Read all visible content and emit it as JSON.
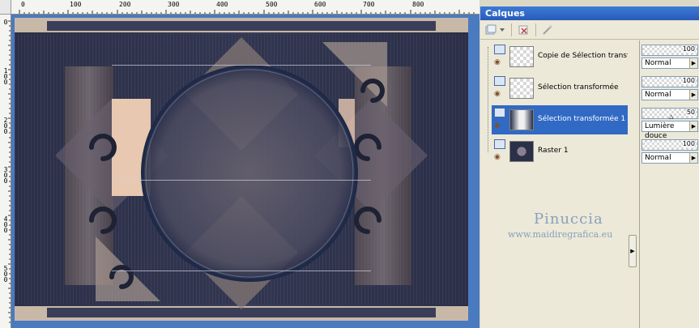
{
  "ruler": {
    "h_ticks": [
      "0",
      "100",
      "200",
      "300",
      "400",
      "500",
      "600",
      "700",
      "800"
    ],
    "v_ticks": [
      "0",
      "100",
      "200",
      "300",
      "400",
      "500"
    ]
  },
  "palette": {
    "title": "Calques",
    "layers": [
      {
        "name": "Copie de Sélection transfor",
        "opacity": "100",
        "blend": "Normal"
      },
      {
        "name": "Sélection transformée",
        "opacity": "100",
        "blend": "Normal"
      },
      {
        "name": "Sélection transformée 1",
        "opacity": "50",
        "blend": "Lumière douce",
        "selected": true
      },
      {
        "name": "Raster 1",
        "opacity": "100",
        "blend": "Normal"
      }
    ]
  },
  "watermark": {
    "title": "Pinuccia",
    "url": "www.maidiregrafica.eu"
  },
  "colors": {
    "workspace": "#4a7abf",
    "title_bar": "#2a5bb8",
    "selected_row": "#316ac5",
    "watermark": "#8aa0bc"
  },
  "icons": [
    "new-layer-icon",
    "dropdown-arrow-icon",
    "delete-layer-icon",
    "mask-wand-icon",
    "visibility-icon",
    "eye-icon",
    "scroll-arrow-icon"
  ]
}
